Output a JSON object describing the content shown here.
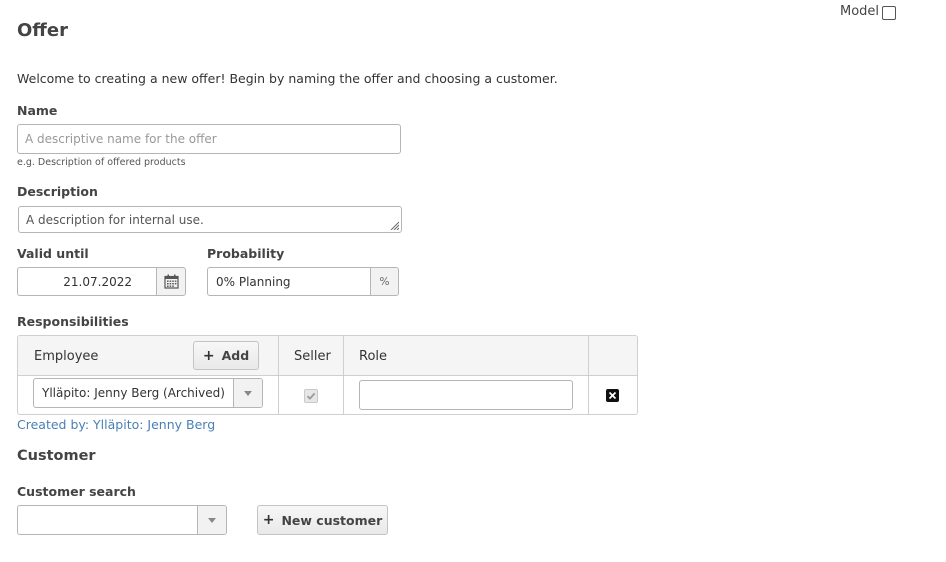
{
  "header": {
    "model_label": "Model",
    "title": "Offer"
  },
  "intro": "Welcome to creating a new offer! Begin by naming the offer and choosing a customer.",
  "name_field": {
    "label": "Name",
    "placeholder": "A descriptive name for the offer",
    "hint": "e.g. Description of offered products"
  },
  "description_field": {
    "label": "Description",
    "placeholder": "A description for internal use."
  },
  "valid_until": {
    "label": "Valid until",
    "value": "21.07.2022"
  },
  "probability": {
    "label": "Probability",
    "value": "0% Planning",
    "addon": "%"
  },
  "responsibilities": {
    "label": "Responsibilities",
    "columns": {
      "employee": "Employee",
      "add_button": "Add",
      "seller": "Seller",
      "role": "Role"
    },
    "rows": [
      {
        "employee": "Ylläpito: Jenny Berg (Archived)",
        "seller": true,
        "role": ""
      }
    ],
    "created_by": "Created by: Ylläpito: Jenny Berg"
  },
  "customer": {
    "section_title": "Customer",
    "search_label": "Customer search",
    "search_value": "",
    "new_customer_button": "New customer"
  },
  "colors": {
    "link": "#4a7fb5",
    "border": "#b5b5b5"
  }
}
